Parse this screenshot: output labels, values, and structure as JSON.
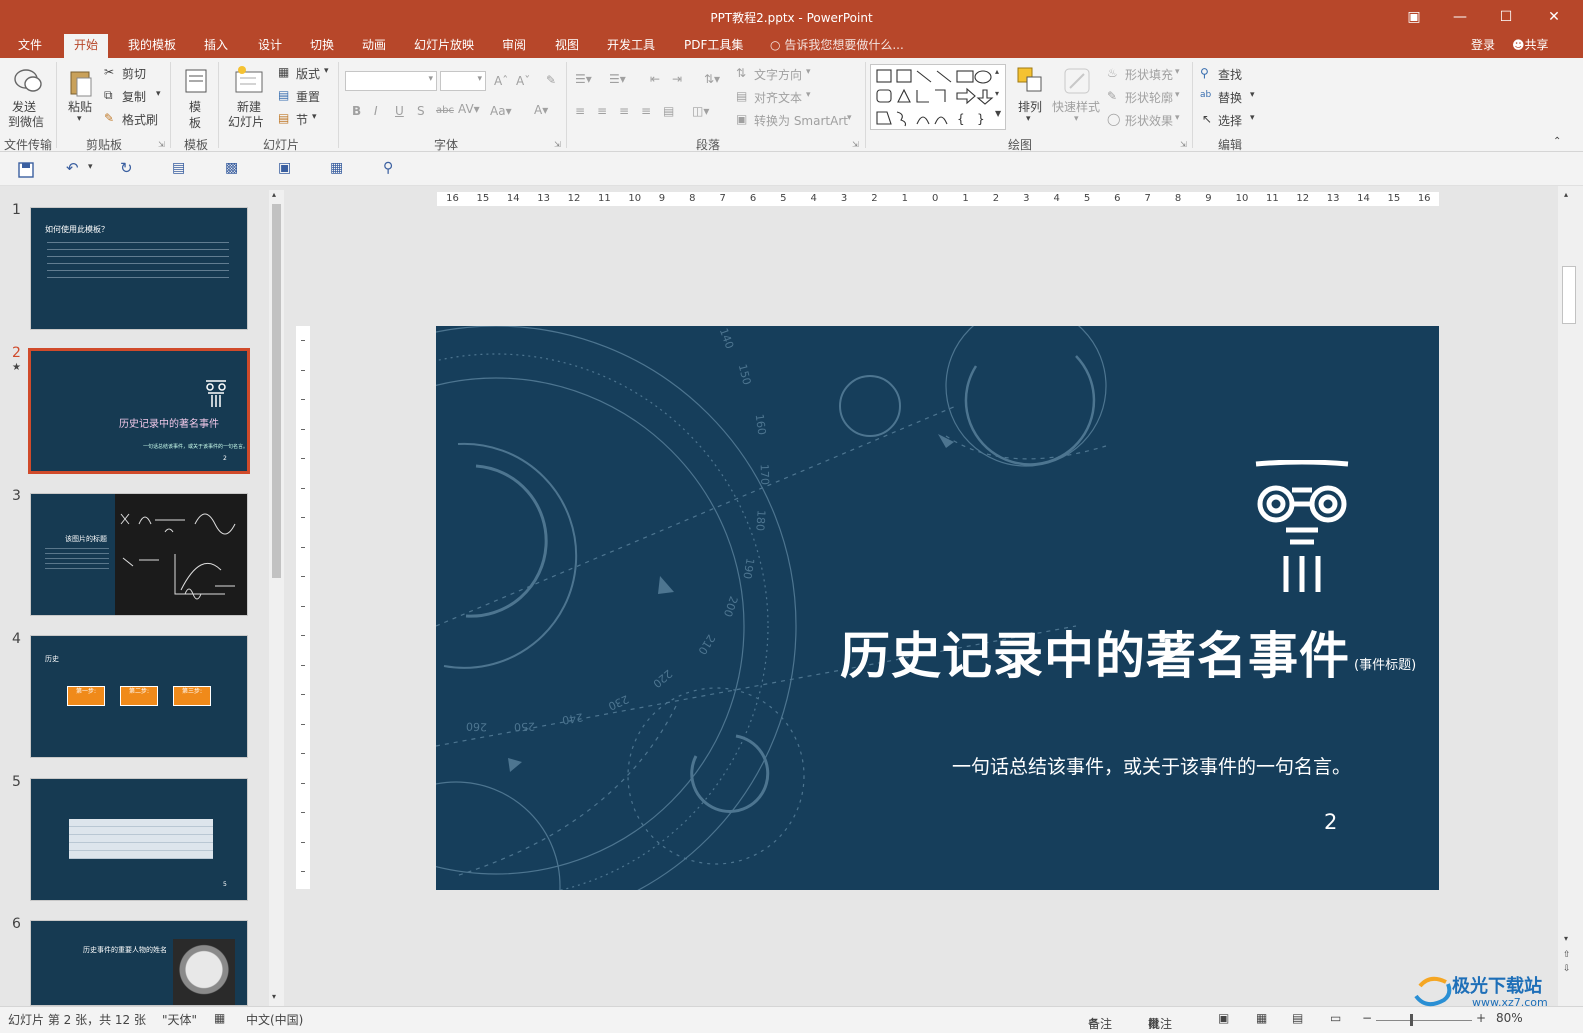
{
  "window": {
    "title": "PPT教程2.pptx - PowerPoint"
  },
  "tabs": [
    "文件",
    "开始",
    "我的模板",
    "插入",
    "设计",
    "切换",
    "动画",
    "幻灯片放映",
    "审阅",
    "视图",
    "开发工具",
    "PDF工具集"
  ],
  "search_hint": "告诉我您想要做什么...",
  "account": {
    "login": "登录",
    "share": "共享"
  },
  "ribbon": {
    "send": {
      "line1": "发送",
      "line2": "到微信",
      "group": "文件传输"
    },
    "clipboard": {
      "paste": "粘贴",
      "cut": "剪切",
      "copy": "复制",
      "painter": "格式刷",
      "group": "剪贴板"
    },
    "template": {
      "line1": "模",
      "line2": "板",
      "group": "模板"
    },
    "slides": {
      "new_line1": "新建",
      "new_line2": "幻灯片",
      "layout": "版式",
      "reset": "重置",
      "section": "节",
      "group": "幻灯片"
    },
    "font": {
      "bold": "B",
      "italic": "I",
      "underline": "U",
      "shadow": "S",
      "strike": "abc",
      "group": "字体"
    },
    "paragraph": {
      "text_direction": "文字方向",
      "align_text": "对齐文本",
      "smartart": "转换为 SmartArt",
      "group": "段落"
    },
    "drawing": {
      "arrange": "排列",
      "quick_styles": "快速样式",
      "fill": "形状填充",
      "outline": "形状轮廓",
      "effect": "形状效果",
      "group": "绘图"
    },
    "editing": {
      "find": "查找",
      "replace": "替换",
      "select": "选择",
      "group": "编辑"
    }
  },
  "ruler": {
    "h_labels": [
      "16",
      "15",
      "14",
      "13",
      "12",
      "11",
      "10",
      "9",
      "8",
      "7",
      "6",
      "5",
      "4",
      "3",
      "2",
      "1",
      "0",
      "1",
      "2",
      "3",
      "4",
      "5",
      "6",
      "7",
      "8",
      "9",
      "10",
      "11",
      "12",
      "13",
      "14",
      "15",
      "16"
    ]
  },
  "thumbnails": [
    {
      "num": "1",
      "title": "如何使用此模板？"
    },
    {
      "num": "2",
      "title": "历史记录中的著名事件",
      "sub": "一句话总结该事件，或关于该事件的一句名言。",
      "page": "2",
      "star": "★"
    },
    {
      "num": "3",
      "title": "该图片的标题"
    },
    {
      "num": "4",
      "title": "历史",
      "steps": [
        "第一步:",
        "第二步:",
        "第三步:"
      ]
    },
    {
      "num": "5",
      "page": "5"
    },
    {
      "num": "6",
      "title": "历史事件的重要人物的姓名"
    }
  ],
  "slide": {
    "title": "历史记录中的著名事件",
    "title_note": "(事件标题)",
    "subtitle": "一句话总结该事件，或关于该事件的一句名言。",
    "page": "2",
    "dial_labels": [
      "140",
      "150",
      "160",
      "170",
      "180",
      "190",
      "200",
      "210",
      "220",
      "230",
      "240",
      "250",
      "260"
    ],
    "colors": {
      "bg": "#163e5b",
      "accent": "#b7472a"
    }
  },
  "status": {
    "slide_info": "幻灯片 第 2 张，共 12 张",
    "theme": "\"天体\"",
    "language": "中文(中国)",
    "notes": "备注",
    "comments": "批注",
    "zoom": "80%"
  },
  "watermark": {
    "site": "极光下载站",
    "url": "www.xz7.com"
  }
}
